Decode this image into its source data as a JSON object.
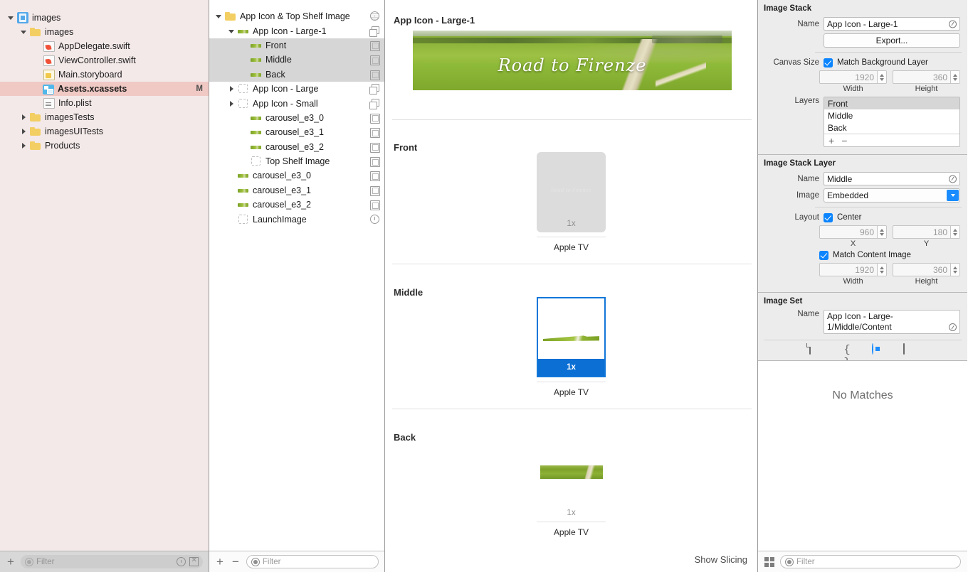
{
  "navigator": {
    "items": [
      {
        "label": "images",
        "icon": "project-icon",
        "twisty": "open",
        "indent": 0,
        "status": ""
      },
      {
        "label": "images",
        "icon": "folder-icon",
        "twisty": "open",
        "indent": 1,
        "status": ""
      },
      {
        "label": "AppDelegate.swift",
        "icon": "swift-file-icon",
        "twisty": "",
        "indent": 2,
        "status": ""
      },
      {
        "label": "ViewController.swift",
        "icon": "swift-file-icon",
        "twisty": "",
        "indent": 2,
        "status": ""
      },
      {
        "label": "Main.storyboard",
        "icon": "storyboard-icon",
        "twisty": "",
        "indent": 2,
        "status": ""
      },
      {
        "label": "Assets.xcassets",
        "icon": "assets-icon",
        "twisty": "",
        "indent": 2,
        "status": "M",
        "selected": true
      },
      {
        "label": "Info.plist",
        "icon": "plist-icon",
        "twisty": "",
        "indent": 2,
        "status": ""
      },
      {
        "label": "imagesTests",
        "icon": "folder-icon",
        "twisty": "closed",
        "indent": 1,
        "status": ""
      },
      {
        "label": "imagesUITests",
        "icon": "folder-icon",
        "twisty": "closed",
        "indent": 1,
        "status": ""
      },
      {
        "label": "Products",
        "icon": "folder-icon",
        "twisty": "closed",
        "indent": 1,
        "status": ""
      }
    ],
    "bottom": {
      "add_label": "+",
      "filter_placeholder": "Filter",
      "search_icon": "magnifier-icon",
      "recent_icon": "clock-icon",
      "scope_icon": "box-icon"
    }
  },
  "asset_list": {
    "items": [
      {
        "label": "App Icon & Top Shelf Image",
        "thumb": "folder-icon",
        "badge": "globe-icon",
        "twisty": "open",
        "indent": 0
      },
      {
        "label": "App Icon - Large-1",
        "thumb": "landscape-thumb",
        "badge": "stack-icon",
        "twisty": "open",
        "indent": 1
      },
      {
        "label": "Front",
        "thumb": "landscape-thumb",
        "badge": "imageset-icon",
        "twisty": "",
        "indent": 2,
        "selected": true
      },
      {
        "label": "Middle",
        "thumb": "landscape-thumb",
        "badge": "imageset-icon",
        "twisty": "",
        "indent": 2,
        "selected": true
      },
      {
        "label": "Back",
        "thumb": "landscape-thumb",
        "badge": "imageset-icon",
        "twisty": "",
        "indent": 2,
        "selected": true
      },
      {
        "label": "App Icon - Large",
        "thumb": "empty-thumb",
        "badge": "stack-icon",
        "twisty": "closed",
        "indent": 1
      },
      {
        "label": "App Icon - Small",
        "thumb": "empty-thumb",
        "badge": "stack-icon",
        "twisty": "closed",
        "indent": 1
      },
      {
        "label": "carousel_e3_0",
        "thumb": "landscape-thumb",
        "badge": "imageset-icon",
        "twisty": "",
        "indent": 2
      },
      {
        "label": "carousel_e3_1",
        "thumb": "landscape-thumb",
        "badge": "imageset-icon",
        "twisty": "",
        "indent": 2
      },
      {
        "label": "carousel_e3_2",
        "thumb": "landscape-thumb",
        "badge": "imageset-icon",
        "twisty": "",
        "indent": 2
      },
      {
        "label": "Top Shelf Image",
        "thumb": "empty-thumb",
        "badge": "imageset-icon",
        "twisty": "",
        "indent": 2
      },
      {
        "label": "carousel_e3_0",
        "thumb": "landscape-thumb",
        "badge": "imageset-icon",
        "twisty": "",
        "indent": 1
      },
      {
        "label": "carousel_e3_1",
        "thumb": "landscape-thumb",
        "badge": "imageset-icon",
        "twisty": "",
        "indent": 1
      },
      {
        "label": "carousel_e3_2",
        "thumb": "landscape-thumb",
        "badge": "imageset-icon",
        "twisty": "",
        "indent": 1
      },
      {
        "label": "LaunchImage",
        "thumb": "empty-thumb",
        "badge": "clock-icon",
        "twisty": "",
        "indent": 1
      }
    ],
    "bottom": {
      "add_label": "+",
      "remove_label": "−",
      "filter_placeholder": "Filter",
      "search_icon": "magnifier-icon"
    }
  },
  "canvas": {
    "title": "App Icon - Large-1",
    "hero_caption": "Road to Firenze",
    "sections": [
      {
        "title": "Front",
        "scale": "1x",
        "device": "Apple TV",
        "state": "empty"
      },
      {
        "title": "Middle",
        "scale": "1x",
        "device": "Apple TV",
        "state": "selected"
      },
      {
        "title": "Back",
        "scale": "1x",
        "device": "Apple TV",
        "state": "filled"
      }
    ],
    "show_slicing": "Show Slicing"
  },
  "inspector": {
    "image_stack": {
      "heading": "Image Stack",
      "name_label": "Name",
      "name_value": "App Icon - Large-1",
      "export_label": "Export...",
      "canvas_size_label": "Canvas Size",
      "match_bg_label": "Match Background Layer",
      "match_bg_checked": true,
      "width_value": "1920",
      "width_caption": "Width",
      "height_value": "360",
      "height_caption": "Height",
      "layers_label": "Layers",
      "layers": [
        "Front",
        "Middle",
        "Back"
      ],
      "layers_selected": "Front",
      "add_label": "+",
      "remove_label": "−"
    },
    "image_stack_layer": {
      "heading": "Image Stack Layer",
      "name_label": "Name",
      "name_value": "Middle",
      "image_label": "Image",
      "image_value": "Embedded",
      "layout_label": "Layout",
      "center_label": "Center",
      "center_checked": true,
      "x_value": "960",
      "x_caption": "X",
      "y_value": "180",
      "y_caption": "Y",
      "match_content_label": "Match Content Image",
      "match_content_checked": true,
      "width_value": "1920",
      "width_caption": "Width",
      "height_value": "360",
      "height_caption": "Height"
    },
    "image_set": {
      "heading": "Image Set",
      "name_label": "Name",
      "name_value": "App Icon - Large-1/Middle/Content"
    },
    "tabs": [
      {
        "icon": "file-inspector-icon",
        "selected": false
      },
      {
        "icon": "code-braces-icon",
        "selected": false
      },
      {
        "icon": "attributes-inspector-icon",
        "selected": true
      },
      {
        "icon": "size-inspector-icon",
        "selected": false
      }
    ],
    "library": {
      "empty_message": "No Matches",
      "grid_icon": "grid-icon",
      "filter_placeholder": "Filter",
      "search_icon": "magnifier-icon"
    }
  }
}
